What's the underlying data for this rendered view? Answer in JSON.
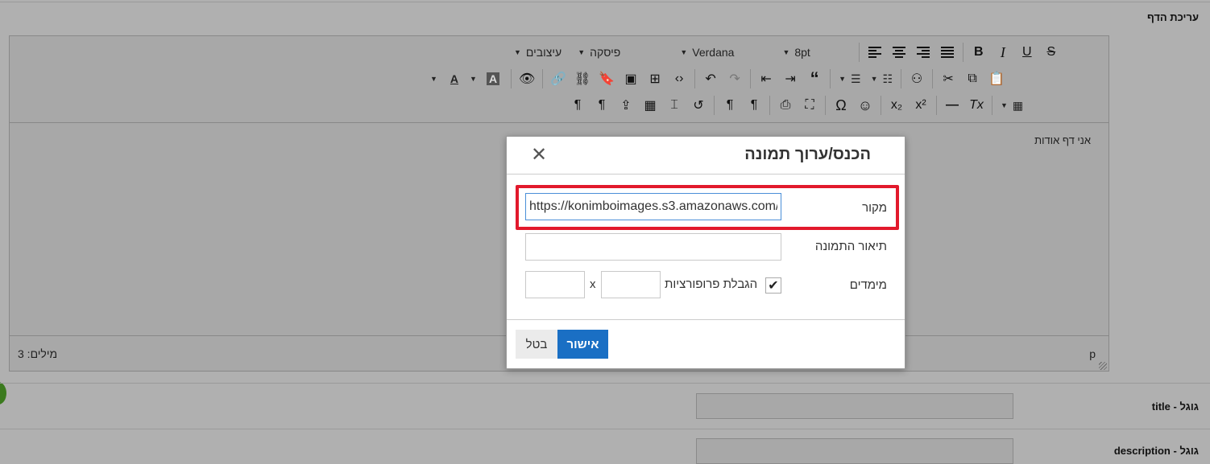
{
  "page": {
    "section_title": "עריכת הדף",
    "google_title_label": "גוגל - title",
    "google_description_label": "גוגל - description"
  },
  "toolbar": {
    "styles_dropdown": "עיצובים",
    "paragraph_dropdown": "פיסקה",
    "font_dropdown": "Verdana",
    "size_dropdown": "8pt",
    "text_color_glyph": "A",
    "bg_color_glyph": "A"
  },
  "editor": {
    "content_text": "אני דף אודות",
    "word_count": "מילים: 3",
    "element_path": "p"
  },
  "dialog": {
    "title": "הכנס/ערוך תמונה",
    "close_glyph": "✕",
    "source_label": "מקור",
    "source_value": "https://konimboimages.s3.amazonaws.com/",
    "description_label": "תיאור התמונה",
    "description_value": "",
    "dimensions_label": "מימדים",
    "width_value": "",
    "height_value": "",
    "times_symbol": "x",
    "constrain_label": "הגבלת פרופורציות",
    "constrain_checked": true,
    "check_glyph": "✔",
    "ok_label": "אישור",
    "cancel_label": "בטל"
  },
  "colors": {
    "overlay_bg": "#b0b0b0",
    "highlight_border": "#e2192c",
    "primary_button": "#1a6fc4"
  }
}
